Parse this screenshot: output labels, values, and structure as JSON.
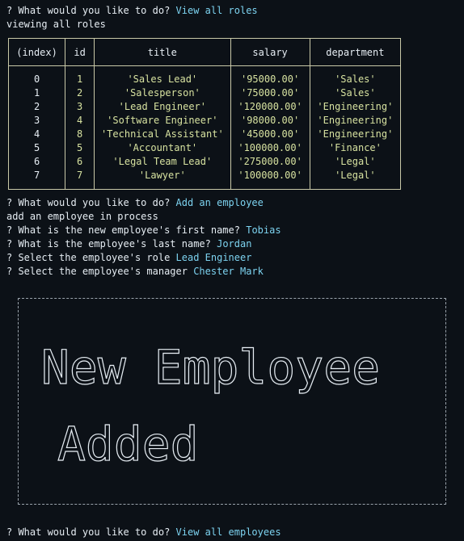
{
  "lines": {
    "l1_q": "? What would you like to do? ",
    "l1_a": "View all roles",
    "l2": "viewing all roles",
    "l3_q": "? What would you like to do? ",
    "l3_a": "Add an employee",
    "l4": "add an employee in process",
    "l5_q": "? What is the new employee's first name? ",
    "l5_a": "Tobias",
    "l6_q": "? What is the employee's last name? ",
    "l6_a": "Jordan",
    "l7_q": "? Select the employee's role ",
    "l7_a": "Lead Engineer",
    "l8_q": "? Select the employee's manager ",
    "l8_a": "Chester Mark",
    "l9_q": "? What would you like to do? ",
    "l9_a": "View all employees"
  },
  "table": {
    "headers": [
      "(index)",
      "id",
      "title",
      "salary",
      "department"
    ],
    "rows": [
      {
        "index": "0",
        "id": "1",
        "title": "'Sales Lead'",
        "salary": "'95000.00'",
        "department": "'Sales'"
      },
      {
        "index": "1",
        "id": "2",
        "title": "'Salesperson'",
        "salary": "'75000.00'",
        "department": "'Sales'"
      },
      {
        "index": "2",
        "id": "3",
        "title": "'Lead Engineer'",
        "salary": "'120000.00'",
        "department": "'Engineering'"
      },
      {
        "index": "3",
        "id": "4",
        "title": "'Software Engineer'",
        "salary": "'98000.00'",
        "department": "'Engineering'"
      },
      {
        "index": "4",
        "id": "8",
        "title": "'Technical Assistant'",
        "salary": "'45000.00'",
        "department": "'Engineering'"
      },
      {
        "index": "5",
        "id": "5",
        "title": "'Accountant'",
        "salary": "'100000.00'",
        "department": "'Finance'"
      },
      {
        "index": "6",
        "id": "6",
        "title": "'Legal Team Lead'",
        "salary": "'275000.00'",
        "department": "'Legal'"
      },
      {
        "index": "7",
        "id": "7",
        "title": "'Lawyer'",
        "salary": "'100000.00'",
        "department": "'Legal'"
      }
    ]
  },
  "banner": {
    "line1": "New Employee",
    "line2": "Added",
    "color": "#e6edf3"
  },
  "colors": {
    "background": "#0c1117",
    "answer": "#7dd3f0",
    "value": "#d7e2a0",
    "border": "#c9c9a8"
  }
}
